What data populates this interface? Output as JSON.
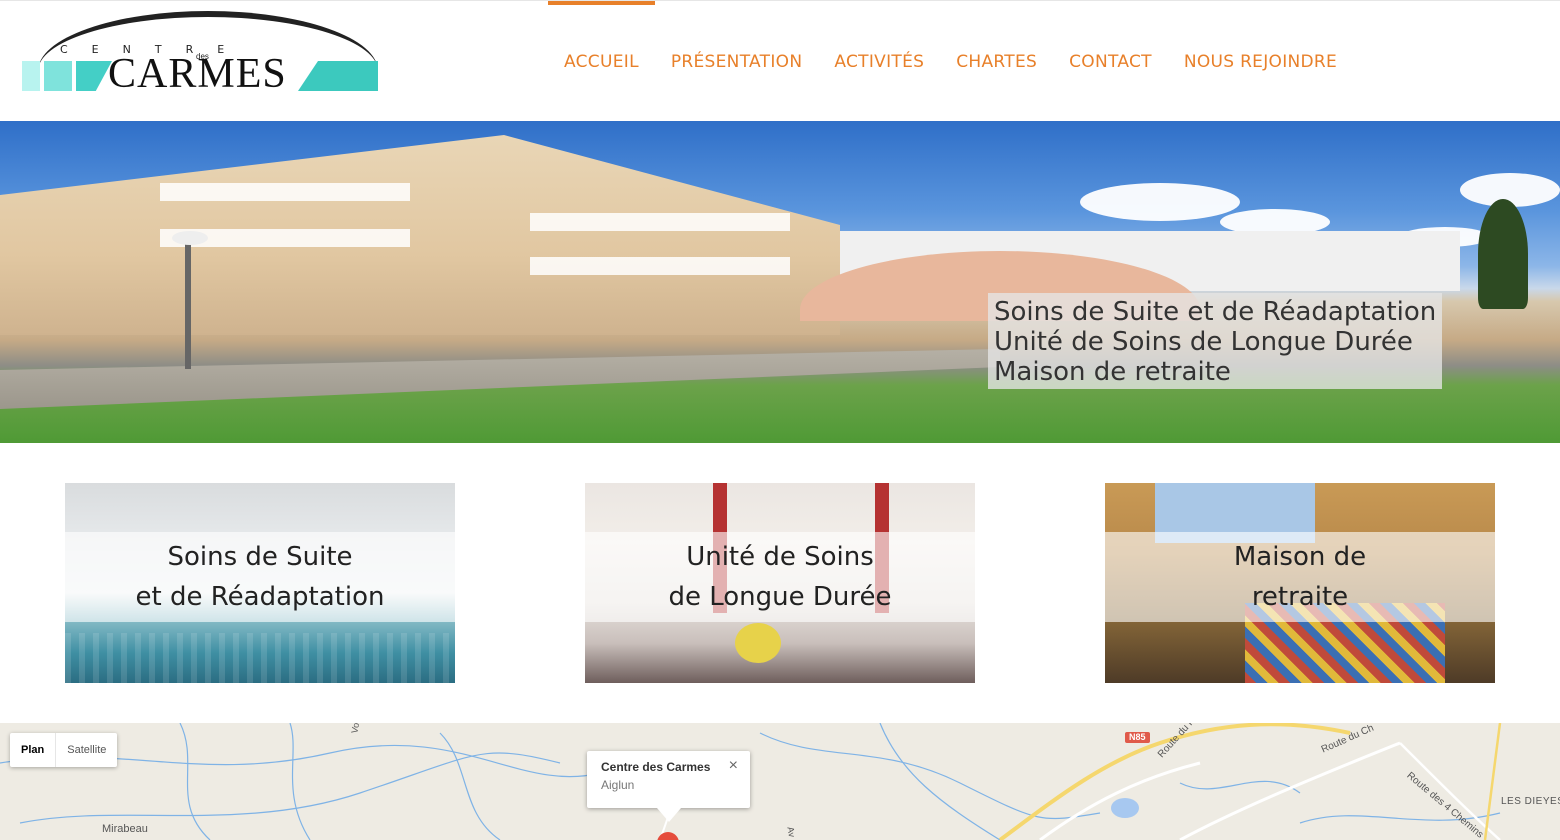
{
  "logo": {
    "line1": "CENTRE",
    "line2": "des",
    "line3": "CARMES"
  },
  "nav": {
    "items": [
      {
        "label": "ACCUEIL",
        "active": true
      },
      {
        "label": "PRÉSENTATION",
        "active": false
      },
      {
        "label": "ACTIVITÉS",
        "active": false
      },
      {
        "label": "CHARTES",
        "active": false
      },
      {
        "label": "CONTACT",
        "active": false
      },
      {
        "label": "NOUS REJOINDRE",
        "active": false
      }
    ]
  },
  "hero": {
    "caption": [
      "Soins de Suite et de Réadaptation",
      "Unité de Soins de Longue Durée",
      "Maison de retraite"
    ]
  },
  "cards": [
    {
      "line1": "Soins de Suite",
      "line2": "et de Réadaptation"
    },
    {
      "line1": "Unité de Soins",
      "line2": "de Longue Durée"
    },
    {
      "line1": "Maison de",
      "line2": "retraite"
    }
  ],
  "map": {
    "type_buttons": {
      "plan": "Plan",
      "satellite": "Satellite"
    },
    "info": {
      "title": "Centre des Carmes",
      "subtitle": "Aiglun",
      "close": "×"
    },
    "labels": {
      "mirabeau": "Mirabeau",
      "les_dieyes": "LES DIEYES",
      "route_plan": "Route du Plan de",
      "route_ch": "Route du Ch",
      "route_4chemins": "Route des 4 Chemins",
      "n85": "N85",
      "vo": "Vo",
      "av": "Av"
    }
  },
  "colors": {
    "accent": "#e8802a",
    "teal": "#3cc9be"
  }
}
